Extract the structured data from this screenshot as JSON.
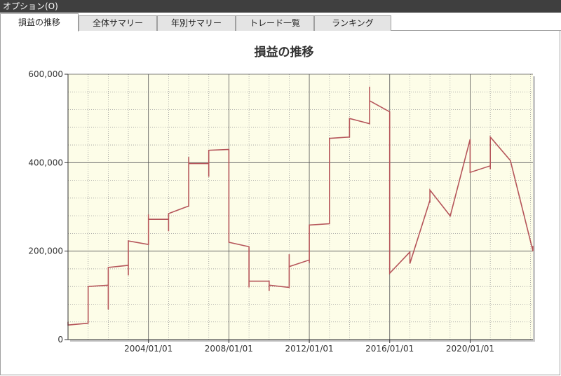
{
  "window": {
    "title": "オプション(O)"
  },
  "tabs": [
    {
      "label": "損益の推移",
      "active": true
    },
    {
      "label": "全体サマリー",
      "active": false
    },
    {
      "label": "年別サマリー",
      "active": false
    },
    {
      "label": "トレード一覧",
      "active": false
    },
    {
      "label": "ランキング",
      "active": false
    }
  ],
  "colors": {
    "plot_bg": "#fdfde8",
    "line": "#b5555a",
    "titlebar": "#3f3f3f"
  },
  "chart_data": {
    "type": "line",
    "title": "損益の推移",
    "xlabel": "",
    "ylabel": "",
    "xlim": [
      "2000/01/01",
      "2023/02/15"
    ],
    "ylim": [
      0,
      600000
    ],
    "y_ticks": [
      0,
      200000,
      400000,
      600000
    ],
    "y_tick_labels": [
      "0",
      "200,000",
      "400,000",
      "600,000"
    ],
    "x_ticks": [
      "2004/01/01",
      "2008/01/01",
      "2012/01/01",
      "2016/01/01",
      "2020/01/01"
    ],
    "x_tick_labels": [
      "2004/01/01",
      "2008/01/01",
      "2012/01/01",
      "2016/01/01",
      "2020/01/01"
    ],
    "grid": true,
    "legend": "none",
    "series": [
      {
        "name": "",
        "x": [
          "2000/01/01",
          "2000/01/01",
          "2001/01/01",
          "2001/01/01",
          "2002/01/01",
          "2002/01/01",
          "2002/01/01",
          "2003/01/01",
          "2003/01/01",
          "2003/01/01",
          "2004/01/01",
          "2004/01/01",
          "2004/01/01",
          "2005/01/01",
          "2005/01/01",
          "2005/01/01",
          "2006/01/01",
          "2006/01/01",
          "2006/01/01",
          "2007/01/01",
          "2007/01/01",
          "2007/01/01",
          "2008/01/01",
          "2008/01/01",
          "2009/01/01",
          "2009/01/01",
          "2009/01/01",
          "2010/01/01",
          "2010/01/01",
          "2010/01/01",
          "2011/01/01",
          "2011/01/01",
          "2011/01/01",
          "2012/01/01",
          "2012/01/01",
          "2012/01/01",
          "2013/01/01",
          "2013/01/01",
          "2014/01/01",
          "2014/01/01",
          "2014/01/01",
          "2015/01/01",
          "2015/01/01",
          "2015/01/01",
          "2016/01/01",
          "2016/01/01",
          "2017/01/01",
          "2017/01/01",
          "2018/01/01",
          "2018/01/01",
          "2018/01/01",
          "2019/01/01",
          "2019/01/01",
          "2020/01/01",
          "2020/01/01",
          "2020/01/01",
          "2021/01/01",
          "2021/01/01",
          "2021/01/01",
          "2022/01/01",
          "2022/01/01",
          "2023/02/15",
          "2023/02/15"
        ],
        "values": [
          40000,
          33000,
          37000,
          120000,
          123000,
          68000,
          163000,
          168000,
          145000,
          223000,
          215000,
          283000,
          272000,
          272000,
          245000,
          285000,
          302000,
          413000,
          398000,
          398000,
          368000,
          428000,
          430000,
          220000,
          210000,
          118000,
          132000,
          132000,
          110000,
          123000,
          118000,
          193000,
          165000,
          180000,
          173000,
          259000,
          262000,
          455000,
          458000,
          500000,
          500000,
          488000,
          572000,
          540000,
          515000,
          150000,
          198000,
          172000,
          315000,
          310000,
          338000,
          280000,
          278000,
          453000,
          448000,
          378000,
          393000,
          385000,
          458000,
          405000,
          405000,
          200000,
          212000
        ]
      }
    ]
  }
}
